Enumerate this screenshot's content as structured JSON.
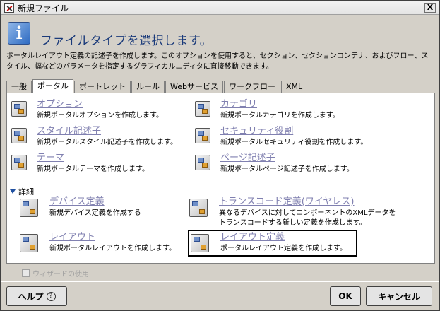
{
  "window": {
    "title": "新規ファイル",
    "close_label": "X"
  },
  "header": {
    "icon_letter": "i",
    "title": "ファイルタイプを選択します。"
  },
  "description": "ポータルレイアウト定義の記述子を作成します。このオプションを使用すると、セクション、セクションコンテナ、およびフロー、スタイル、幅などのパラメータを指定するグラフィカルエディタに直接移動できます。",
  "tabs": [
    {
      "label": "一般",
      "active": false
    },
    {
      "label": "ポータル",
      "active": true
    },
    {
      "label": "ポートレット",
      "active": false
    },
    {
      "label": "ルール",
      "active": false
    },
    {
      "label": "Webサービス",
      "active": false
    },
    {
      "label": "ワークフロー",
      "active": false
    },
    {
      "label": "XML",
      "active": false
    }
  ],
  "items": {
    "option": {
      "title": "オプション",
      "desc": "新規ポータルオプションを作成します。"
    },
    "category": {
      "title": "カテゴリ",
      "desc": "新規ポータルカテゴリを作成します。"
    },
    "style": {
      "title": "スタイル記述子",
      "desc": "新規ポータルスタイル記述子を作成します。"
    },
    "security": {
      "title": "セキュリティ役割",
      "desc": "新規ポータルセキュリティ役割を作成します。"
    },
    "theme": {
      "title": "テーマ",
      "desc": "新規ポータルテーマを作成します。"
    },
    "page": {
      "title": "ページ記述子",
      "desc": "新規ポータルページ記述子を作成します。"
    }
  },
  "details": {
    "label": "詳細",
    "device": {
      "title": "デバイス定義",
      "desc": "新規デバイス定義を作成する"
    },
    "transcode": {
      "title": "トランスコード定義(ワイヤレス)",
      "desc1": "異なるデバイスに対してコンポーネントのXMLデータを",
      "desc2": "トランスコードする新しい定義を作成します。"
    },
    "layout": {
      "title": "レイアウト",
      "desc": "新規ポータルレイアウトを作成します。"
    },
    "layout_def": {
      "title": "レイアウト定義",
      "desc": "ポータルレイアウト定義を作成します。"
    }
  },
  "wizard_label": "ウィザードの使用",
  "buttons": {
    "help": "ヘルプ",
    "help_icon": "?",
    "ok": "OK",
    "cancel": "キャンセル"
  }
}
